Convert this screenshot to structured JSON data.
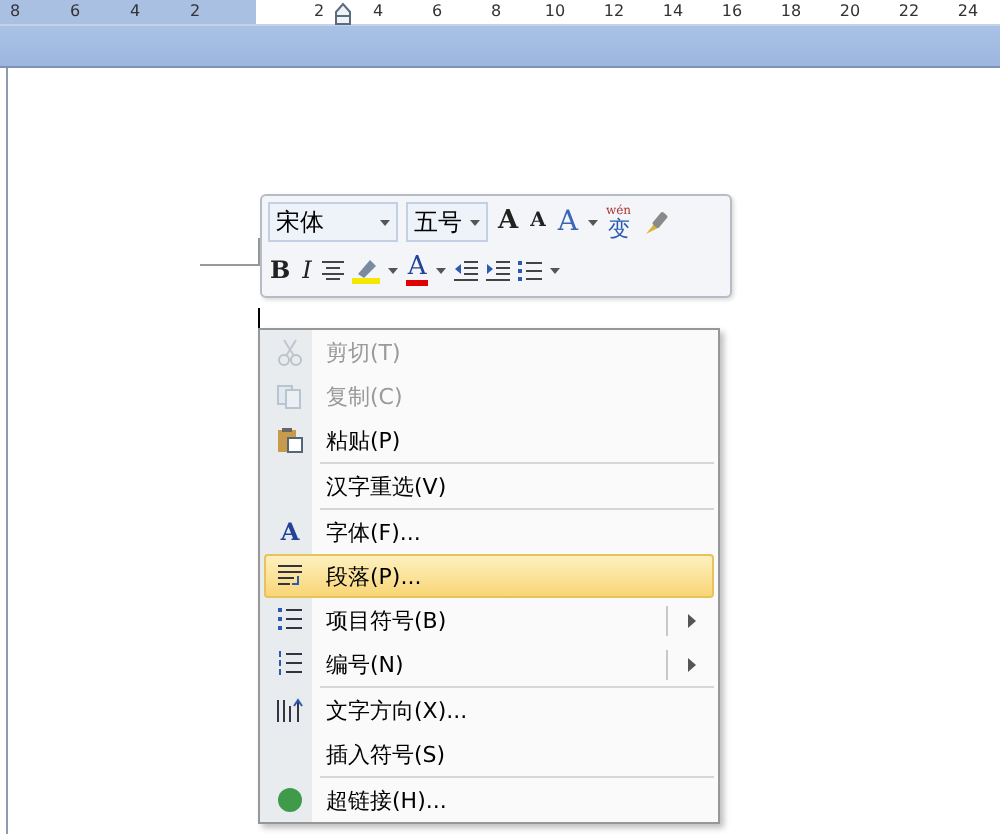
{
  "ruler": {
    "left_marks": [
      "8",
      "6",
      "4",
      "2"
    ],
    "right_marks": [
      "2",
      "4",
      "6",
      "8",
      "10",
      "12",
      "14",
      "16",
      "18",
      "20",
      "22",
      "24"
    ]
  },
  "mini_toolbar": {
    "font_name": "宋体",
    "font_size": "五号",
    "row_1": [
      {
        "kind": "grow",
        "glyph": "A"
      },
      {
        "kind": "shrink",
        "glyph": "A"
      },
      {
        "kind": "styles",
        "glyph": "A"
      },
      {
        "kind": "phonetic",
        "ruby": "wén",
        "glyph": "变"
      },
      {
        "kind": "format_painter"
      }
    ],
    "row_2": [
      {
        "kind": "bold",
        "glyph": "B"
      },
      {
        "kind": "italic",
        "glyph": "I"
      },
      {
        "kind": "center"
      },
      {
        "kind": "highlight"
      },
      {
        "kind": "font_color",
        "glyph": "A"
      },
      {
        "kind": "outdent"
      },
      {
        "kind": "indent"
      },
      {
        "kind": "bullets"
      }
    ]
  },
  "context_menu": [
    {
      "label": "剪切(T)",
      "disabled": true,
      "selected": false,
      "submenu": false,
      "divider_below": false
    },
    {
      "label": "复制(C)",
      "disabled": true,
      "selected": false,
      "submenu": false,
      "divider_below": false
    },
    {
      "label": "粘贴(P)",
      "disabled": false,
      "selected": false,
      "submenu": false,
      "divider_below": true
    },
    {
      "label": "汉字重选(V)",
      "disabled": false,
      "selected": false,
      "submenu": false,
      "divider_below": true
    },
    {
      "label": "字体(F)...",
      "glyph": "A",
      "disabled": false,
      "selected": false,
      "submenu": false,
      "divider_below": false
    },
    {
      "label": "段落(P)...",
      "disabled": false,
      "selected": true,
      "submenu": false,
      "divider_below": false
    },
    {
      "label": "项目符号(B)",
      "disabled": false,
      "selected": false,
      "submenu": true,
      "divider_below": false
    },
    {
      "label": "编号(N)",
      "disabled": false,
      "selected": false,
      "submenu": true,
      "divider_below": true
    },
    {
      "label": "文字方向(X)...",
      "disabled": false,
      "selected": false,
      "submenu": false,
      "divider_below": false
    },
    {
      "label": "插入符号(S)",
      "disabled": false,
      "selected": false,
      "submenu": false,
      "divider_below": true
    },
    {
      "label": "超链接(H)...",
      "disabled": false,
      "selected": false,
      "submenu": false,
      "divider_below": false
    }
  ]
}
